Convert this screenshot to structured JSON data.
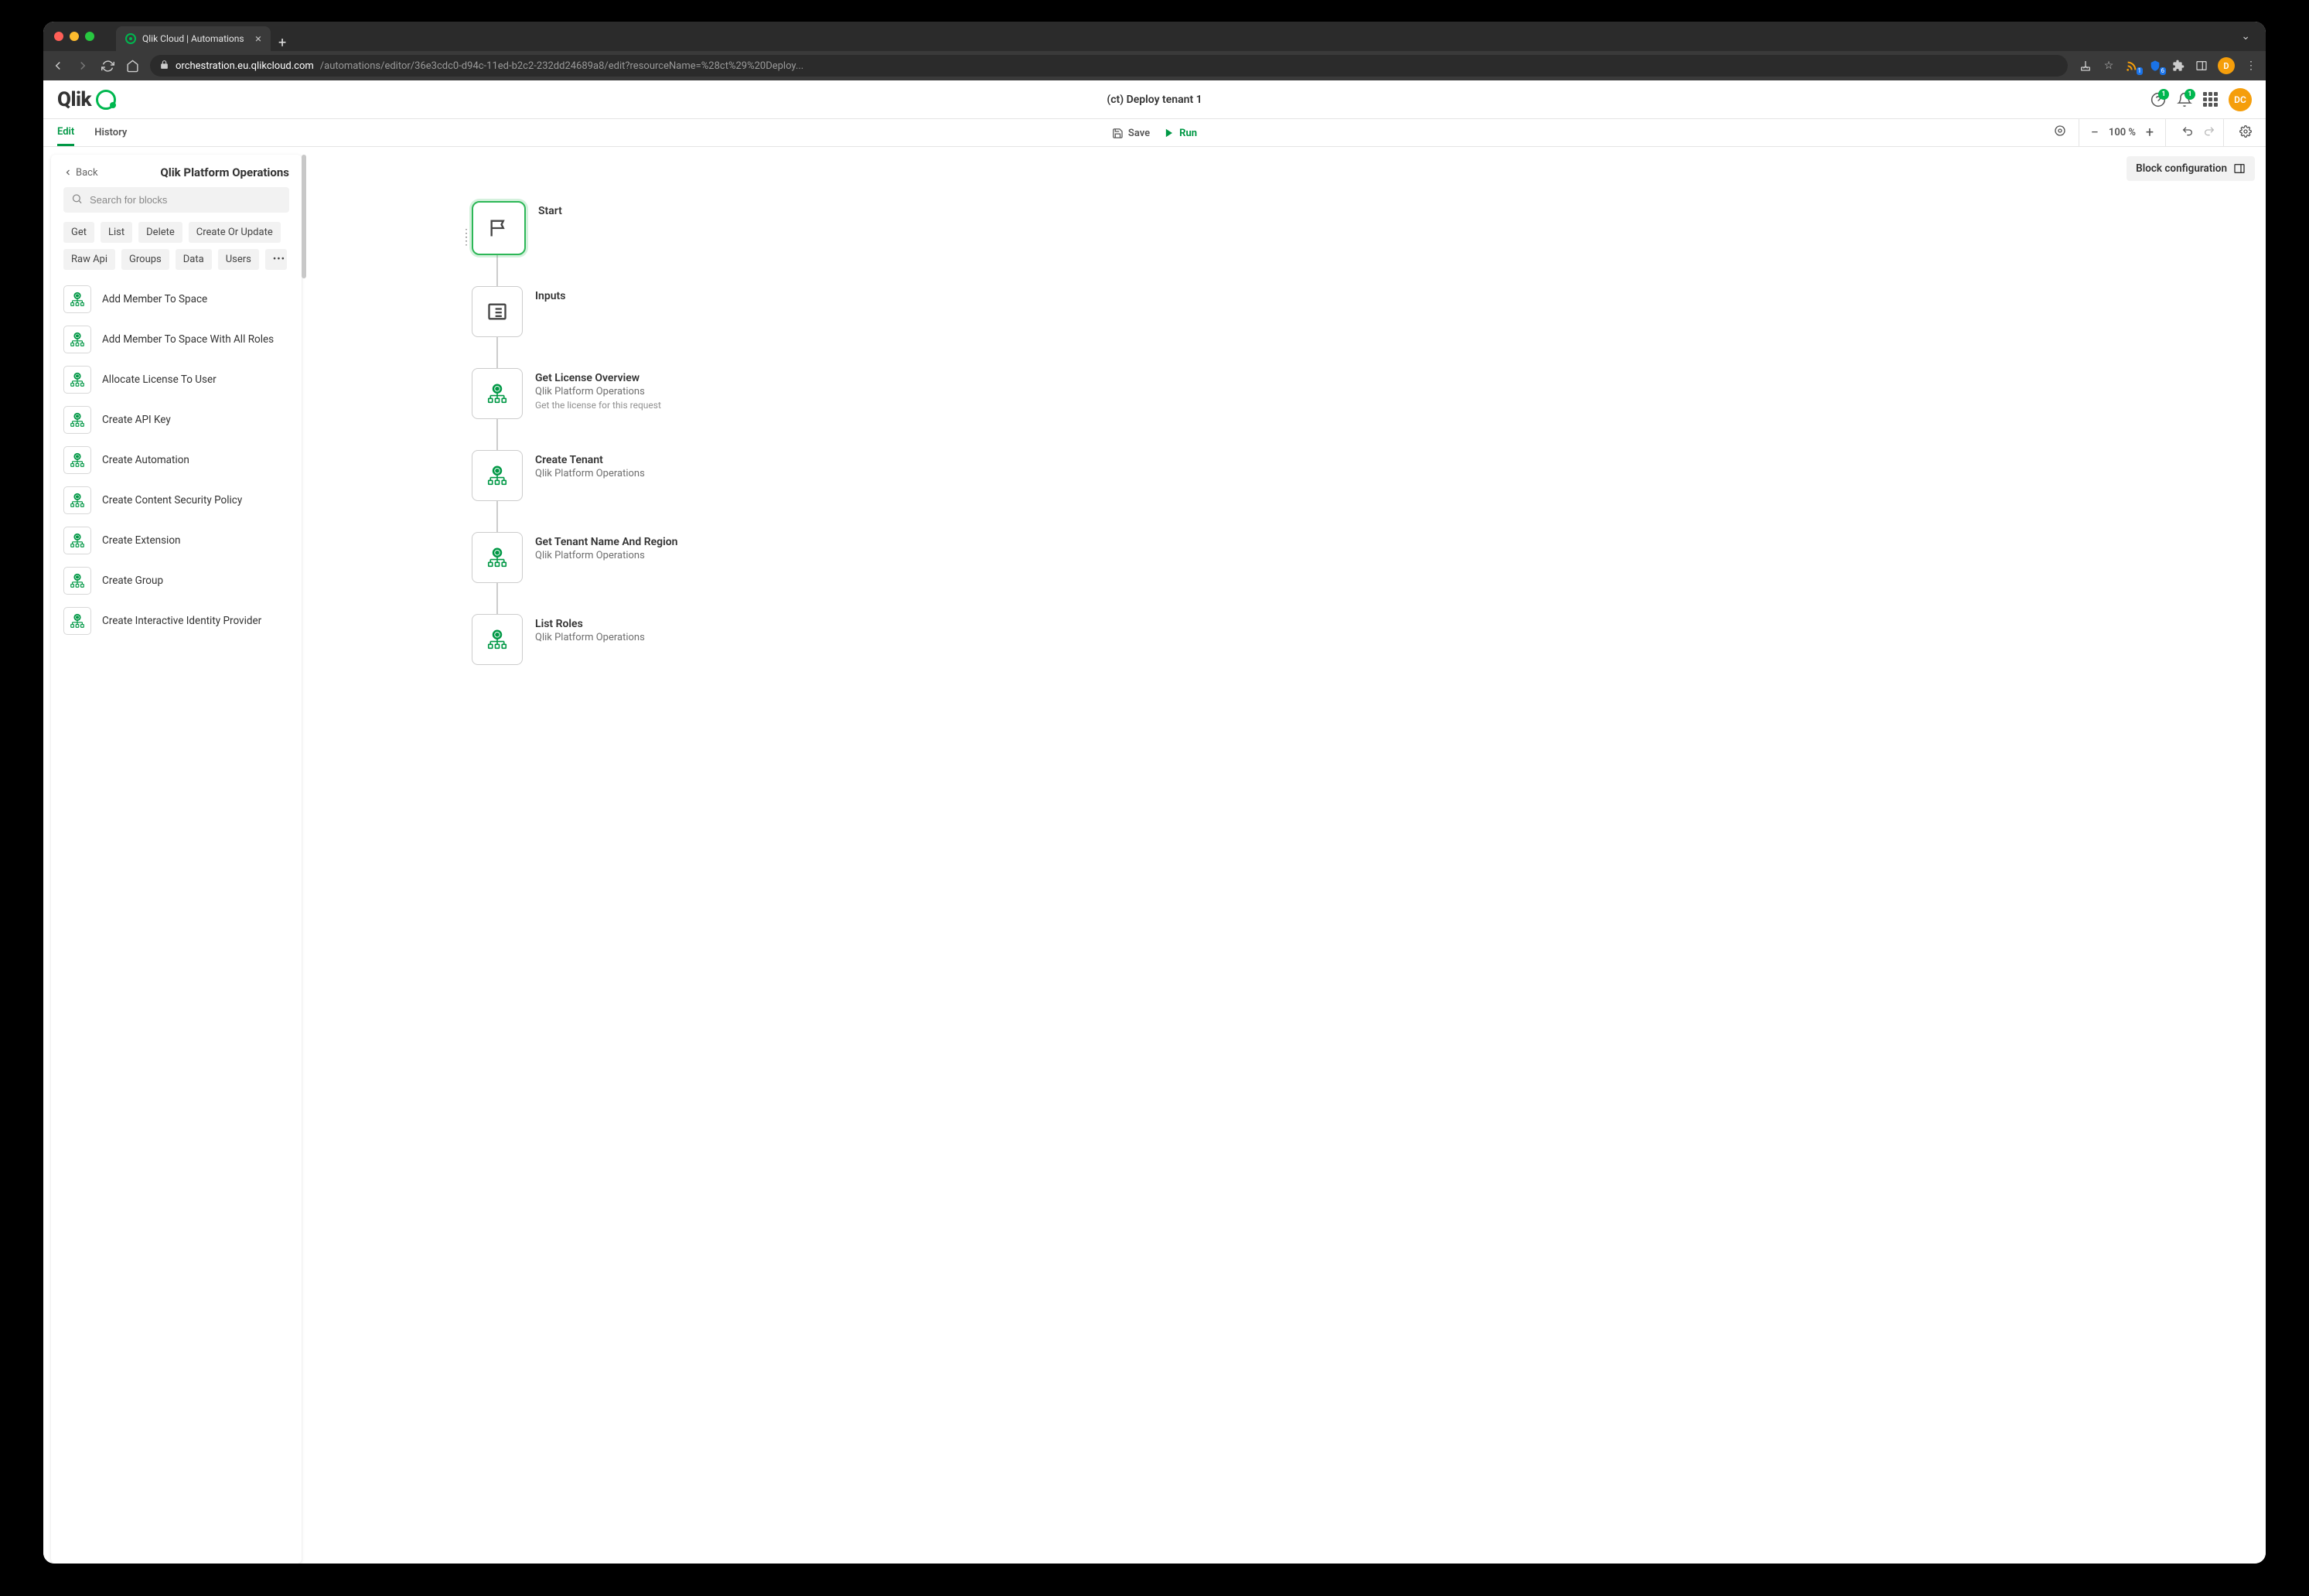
{
  "browser": {
    "tab_title": "Qlik Cloud | Automations",
    "url_domain": "orchestration.eu.qlikcloud.com",
    "url_path": "/automations/editor/36e3cdc0-d94c-11ed-b2c2-232dd24689a8/edit?resourceName=%28ct%29%20Deploy...",
    "ext_badge1": "1",
    "ext_badge2": "6",
    "avatar": "D"
  },
  "header": {
    "logo_text": "Qlik",
    "title": "(ct) Deploy tenant 1",
    "help_badge": "1",
    "bell_badge": "1",
    "avatar": "DC"
  },
  "toolbar": {
    "tab_edit": "Edit",
    "tab_history": "History",
    "save": "Save",
    "run": "Run",
    "zoom": "100 %"
  },
  "sidebar": {
    "back": "Back",
    "title": "Qlik Platform Operations",
    "search_placeholder": "Search for blocks",
    "chips": [
      "Get",
      "List",
      "Delete",
      "Create Or Update",
      "Raw Api",
      "Groups",
      "Data",
      "Users"
    ],
    "chip_more": "•••",
    "blocks": [
      "Add Member To Space",
      "Add Member To Space With All Roles",
      "Allocate License To User",
      "Create API Key",
      "Create Automation",
      "Create Content Security Policy",
      "Create Extension",
      "Create Group",
      "Create Interactive Identity Provider"
    ]
  },
  "canvas": {
    "block_config": "Block configuration",
    "nodes": [
      {
        "title": "Start",
        "sub1": "",
        "sub2": ""
      },
      {
        "title": "Inputs",
        "sub1": "",
        "sub2": ""
      },
      {
        "title": "Get License Overview",
        "sub1": "Qlik Platform Operations",
        "sub2": "Get the license for this request"
      },
      {
        "title": "Create Tenant",
        "sub1": "Qlik Platform Operations",
        "sub2": ""
      },
      {
        "title": "Get Tenant Name And Region",
        "sub1": "Qlik Platform Operations",
        "sub2": ""
      },
      {
        "title": "List Roles",
        "sub1": "Qlik Platform Operations",
        "sub2": ""
      }
    ]
  }
}
